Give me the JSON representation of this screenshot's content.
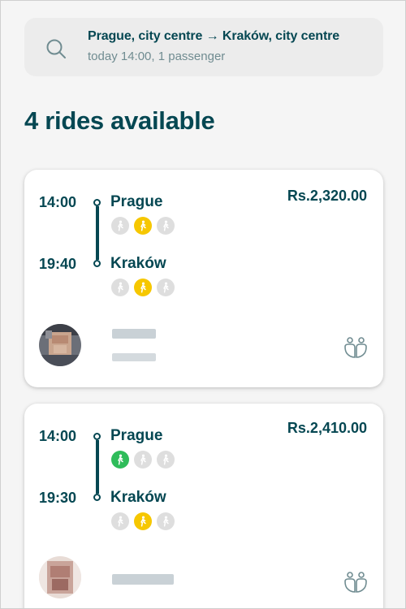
{
  "search": {
    "route": "Prague, city centre → Kraków, city centre",
    "details": "today 14:00, 1 passenger"
  },
  "results": {
    "title": "4 rides available"
  },
  "rides": [
    {
      "departure_time": "14:00",
      "departure_city": "Prague",
      "arrival_time": "19:40",
      "arrival_city": "Kraków",
      "price": "Rs.2,320.00",
      "departure_walk": [
        "grey",
        "yellow",
        "grey"
      ],
      "arrival_walk": [
        "grey",
        "yellow",
        "grey"
      ]
    },
    {
      "departure_time": "14:00",
      "departure_city": "Prague",
      "arrival_time": "19:30",
      "arrival_city": "Kraków",
      "price": "Rs.2,410.00",
      "departure_walk": [
        "green",
        "grey",
        "grey"
      ],
      "arrival_walk": [
        "grey",
        "yellow",
        "grey"
      ]
    }
  ],
  "colors": {
    "primary": "#054752",
    "secondary": "#708c91",
    "walk_yellow": "#f6c700",
    "walk_green": "#2fbc5a",
    "walk_grey": "#dedede"
  }
}
